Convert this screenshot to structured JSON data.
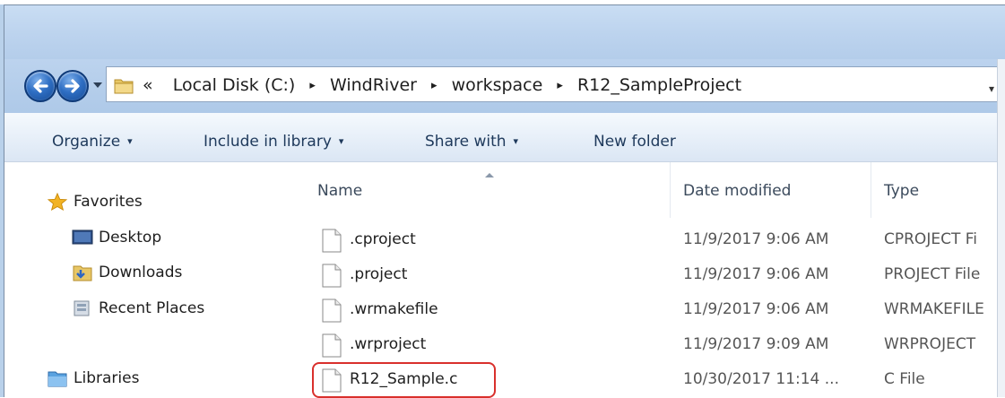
{
  "address_bar": {
    "overflow": "«",
    "crumbs": [
      "Local Disk (C:)",
      "WindRiver",
      "workspace",
      "R12_SampleProject"
    ],
    "separator": "▸",
    "dropdown": "▾"
  },
  "toolbar": {
    "organize": "Organize",
    "include_in_library": "Include in library",
    "share_with": "Share with",
    "new_folder": "New folder",
    "caret": "▾"
  },
  "nav_pane": {
    "favorites": "Favorites",
    "desktop": "Desktop",
    "downloads": "Downloads",
    "recent_places": "Recent Places",
    "libraries": "Libraries"
  },
  "columns": {
    "name": "Name",
    "date_modified": "Date modified",
    "type": "Type"
  },
  "files": [
    {
      "name": ".cproject",
      "date": "11/9/2017 9:06 AM",
      "type": "CPROJECT Fi"
    },
    {
      "name": ".project",
      "date": "11/9/2017 9:06 AM",
      "type": "PROJECT File"
    },
    {
      "name": ".wrmakefile",
      "date": "11/9/2017 9:06 AM",
      "type": "WRMAKEFILE"
    },
    {
      "name": ".wrproject",
      "date": "11/9/2017 9:09 AM",
      "type": "WRPROJECT"
    },
    {
      "name": "R12_Sample.c",
      "date": "10/30/2017 11:14 ...",
      "type": "C File"
    }
  ],
  "colors": {
    "chrome_blue": "#bcd3ee",
    "toolbar_text": "#1e395b",
    "highlight": "#d9302c"
  },
  "icons": {
    "back": "back-arrow-icon",
    "forward": "forward-arrow-icon",
    "folder": "folder-icon",
    "favorites": "star-icon",
    "desktop": "desktop-icon",
    "downloads": "downloads-folder-icon",
    "recent_places": "recent-places-icon",
    "libraries": "libraries-icon",
    "file": "blank-file-icon"
  }
}
